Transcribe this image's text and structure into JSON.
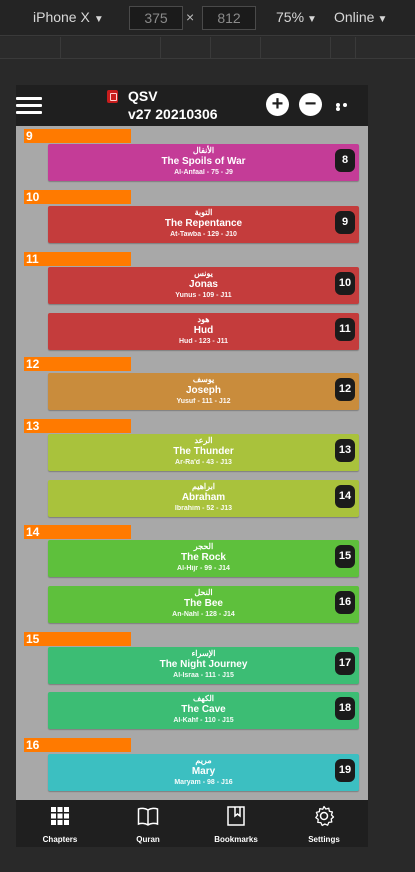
{
  "devtools": {
    "device": "iPhone X",
    "width": "375",
    "height": "812",
    "times": "×",
    "zoom": "75%",
    "network": "Online"
  },
  "app": {
    "title": "QSV",
    "version": "v27 20210306",
    "zoom_in": "+",
    "zoom_out": "−"
  },
  "juz": [
    "9",
    "10",
    "11",
    "12",
    "13",
    "14",
    "15",
    "16"
  ],
  "chapters": [
    {
      "arabic": "الأنفال",
      "english": "The Spoils of War",
      "meta": "Al-Anfaal - 75 - J9",
      "number": "8",
      "color": "#c43c97"
    },
    {
      "arabic": "التوبة",
      "english": "The Repentance",
      "meta": "At-Tawba - 129 - J10",
      "number": "9",
      "color": "#c43c3c"
    },
    {
      "arabic": "يونس",
      "english": "Jonas",
      "meta": "Yunus - 109 - J11",
      "number": "10",
      "color": "#c43c3c"
    },
    {
      "arabic": "هود",
      "english": "Hud",
      "meta": "Hud - 123 - J11",
      "number": "11",
      "color": "#c43c3c"
    },
    {
      "arabic": "يوسف",
      "english": "Joseph",
      "meta": "Yusuf - 111 - J12",
      "number": "12",
      "color": "#c98c3c"
    },
    {
      "arabic": "الرعد",
      "english": "The Thunder",
      "meta": "Ar-Ra'd - 43 - J13",
      "number": "13",
      "color": "#a9c23c"
    },
    {
      "arabic": "ابراهيم",
      "english": "Abraham",
      "meta": "Ibrahim - 52 - J13",
      "number": "14",
      "color": "#a9c23c"
    },
    {
      "arabic": "الحجر",
      "english": "The Rock",
      "meta": "Al-Hijr - 99 - J14",
      "number": "15",
      "color": "#5ec03c"
    },
    {
      "arabic": "النحل",
      "english": "The Bee",
      "meta": "An-Nahl - 128 - J14",
      "number": "16",
      "color": "#5ec03c"
    },
    {
      "arabic": "الإسراء",
      "english": "The Night Journey",
      "meta": "Al-Israa - 111 - J15",
      "number": "17",
      "color": "#3cbd74"
    },
    {
      "arabic": "الكهف",
      "english": "The Cave",
      "meta": "Al-Kahf - 110 - J15",
      "number": "18",
      "color": "#3cbd74"
    },
    {
      "arabic": "مريم",
      "english": "Mary",
      "meta": "Maryam - 98 - J16",
      "number": "19",
      "color": "#3cbfc1"
    }
  ],
  "nav": {
    "chapters": "Chapters",
    "quran": "Quran",
    "bookmarks": "Bookmarks",
    "settings": "Settings"
  }
}
